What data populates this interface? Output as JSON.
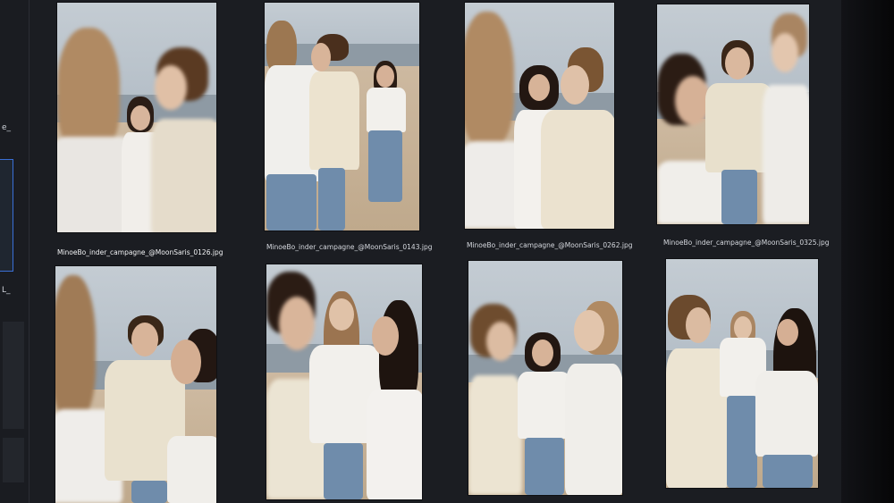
{
  "sidebar": {
    "labels": [
      "e_",
      "L_"
    ]
  },
  "grid": {
    "captions": [
      "MinoeBo_inder_campagne_@MoonSaris_0126.jpg",
      "MinoeBo_inder_campagne_@MoonSaris_0143.jpg",
      "MinoeBo_inder_campagne_@MoonSaris_0262.jpg",
      "MinoeBo_inder_campagne_@MoonSaris_0325.jpg"
    ]
  },
  "colors": {
    "selection_border": "#3a6fd6",
    "grid_background": "#1b1d22"
  }
}
